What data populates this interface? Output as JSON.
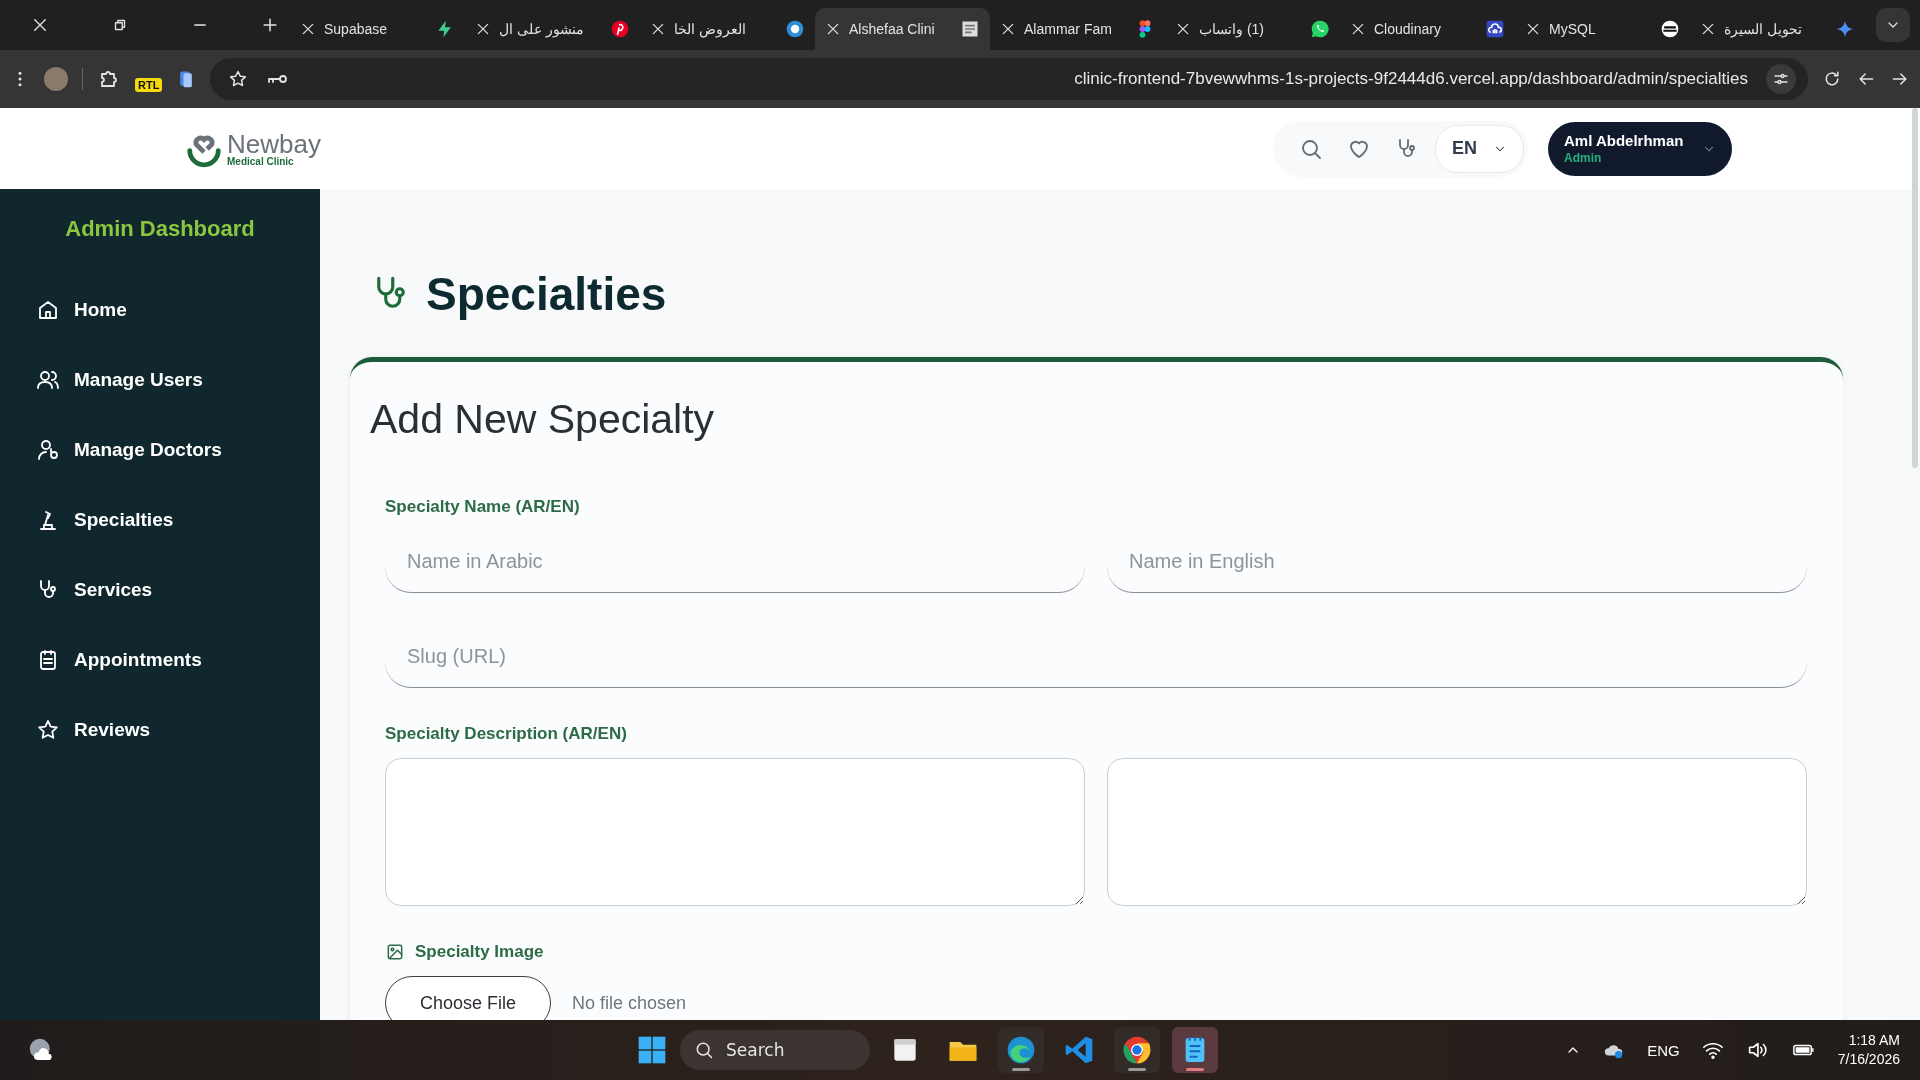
{
  "browser": {
    "tabs": [
      {
        "title": "Supabase",
        "selected": false
      },
      {
        "title": "منشور على ال",
        "selected": false
      },
      {
        "title": "العروض الخا",
        "selected": false
      },
      {
        "title": "Alshefaa Clini",
        "selected": true
      },
      {
        "title": "Alammar Fam",
        "selected": false
      },
      {
        "title": "(1) واتساب",
        "selected": false
      },
      {
        "title": "Cloudinary",
        "selected": false
      },
      {
        "title": "MySQL",
        "selected": false
      },
      {
        "title": "تحويل السيرة",
        "selected": false
      }
    ],
    "extension_badge": "RTL",
    "url": "clinic-frontend-7bvewwhms-1s-projects-9f2444d6.vercel.app/dashboard/admin/specialties"
  },
  "header": {
    "logo_name": "Newbay",
    "logo_tagline": "Medical Clinic",
    "language": "EN",
    "user": {
      "name": "Aml Abdelrhman",
      "role": "Admin"
    }
  },
  "sidebar": {
    "title": "Admin Dashboard",
    "items": [
      {
        "label": "Home"
      },
      {
        "label": "Manage Users"
      },
      {
        "label": "Manage Doctors"
      },
      {
        "label": "Specialties"
      },
      {
        "label": "Services"
      },
      {
        "label": "Appointments"
      },
      {
        "label": "Reviews"
      }
    ]
  },
  "main": {
    "page_title": "Specialties",
    "form": {
      "heading": "Add New Specialty",
      "name_label": "Specialty Name (AR/EN)",
      "name_ar_placeholder": "Name in Arabic",
      "name_en_placeholder": "Name in English",
      "slug_placeholder": "Slug (URL)",
      "description_label": "Specialty Description (AR/EN)",
      "image_label": "Specialty Image",
      "file_button": "Choose File",
      "file_status": "No file chosen"
    }
  },
  "taskbar": {
    "search_placeholder": "Search",
    "apps": [
      {
        "running": false,
        "selected": false
      },
      {
        "running": false,
        "selected": false
      },
      {
        "running": true,
        "selected": false
      },
      {
        "running": false,
        "selected": false
      },
      {
        "running": true,
        "selected": false
      },
      {
        "running": true,
        "selected": true
      }
    ],
    "language": "ENG",
    "time": "1:18 AM",
    "date": "7/16/2026"
  }
}
